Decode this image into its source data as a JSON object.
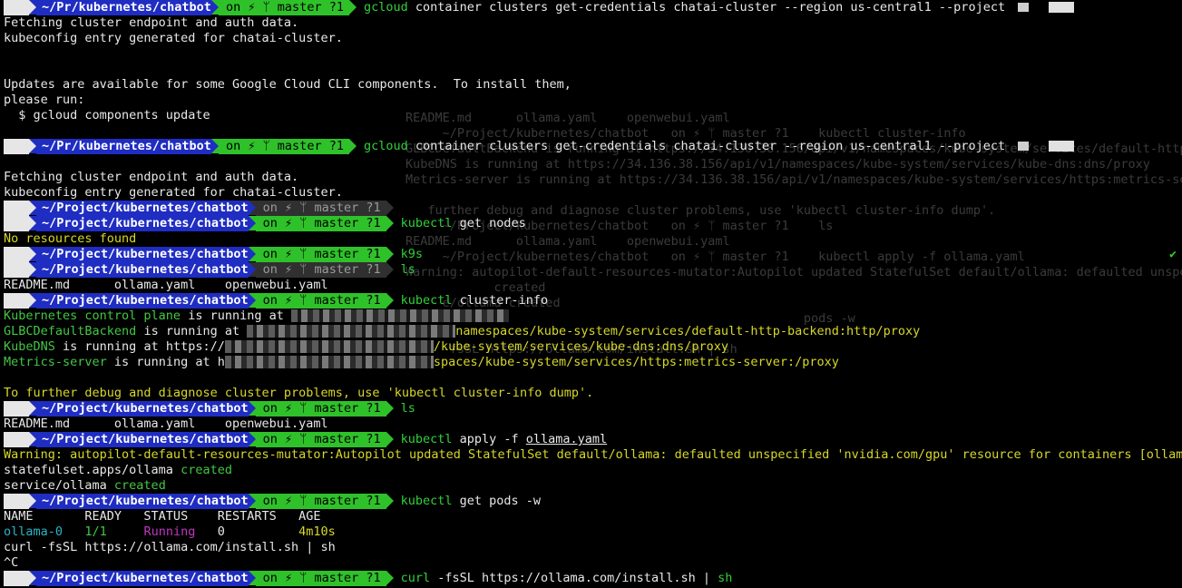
{
  "prompt": {
    "apple_glyph": "",
    "git_label": "on ⚡ ᛘ master ?1",
    "path_short": "~/Pr/kubernetes/chatbot",
    "path_full": "~/Project/kubernetes/chatbot"
  },
  "lines": [
    {
      "kind": "prompt",
      "path": "~/Pr/kubernetes/chatbot",
      "git": "on ⚡ ᛘ master ?1",
      "cmd": "gcloud",
      "args": " container clusters get-credentials chatai-cluster --region us-central1 --project ",
      "redact": true
    },
    {
      "kind": "text",
      "text": "Fetching cluster endpoint and auth data."
    },
    {
      "kind": "text",
      "text": "kubeconfig entry generated for chatai-cluster."
    },
    {
      "kind": "text",
      "text": ""
    },
    {
      "kind": "text",
      "text": ""
    },
    {
      "kind": "text",
      "text": "Updates are available for some Google Cloud CLI components.  To install them,"
    },
    {
      "kind": "text",
      "text": "please run:"
    },
    {
      "kind": "text",
      "text": "  $ gcloud components update"
    },
    {
      "kind": "text",
      "text": ""
    },
    {
      "kind": "prompt",
      "path": "~/Pr/kubernetes/chatbot",
      "git": "on ⚡ ᛘ master ?1",
      "cmd": "gcloud",
      "args": " container clusters get-credentials chatai-cluster --region us-central1 --project ",
      "redact": true
    },
    {
      "kind": "text",
      "text": ""
    },
    {
      "kind": "text",
      "text": "Fetching cluster endpoint and auth data."
    },
    {
      "kind": "text",
      "text": "kubeconfig entry generated for chatai-cluster."
    },
    {
      "kind": "prompt",
      "path": "~/Project/kubernetes/chatbot",
      "git": "on ⚡ ᛘ master ?1",
      "grey": true,
      "cmd": "",
      "args": ""
    },
    {
      "kind": "prompt",
      "path": "~/Project/kubernetes/chatbot",
      "git": "on ⚡ ᛘ master ?1",
      "cmd": "kubectl",
      "args": " get nodes"
    },
    {
      "kind": "colored",
      "color": "yellow",
      "text": "No resources found"
    },
    {
      "kind": "prompt",
      "path": "~/Project/kubernetes/chatbot",
      "git": "on ⚡ ᛘ master ?1",
      "cmd": "k9s",
      "args": ""
    },
    {
      "kind": "prompt",
      "path": "~/Project/kubernetes/chatbot",
      "git": "on ⚡ ᛘ master ?1",
      "grey": true,
      "cmd": "ls",
      "args": ""
    },
    {
      "kind": "text",
      "text": "README.md      ollama.yaml    openwebui.yaml"
    },
    {
      "kind": "prompt",
      "path": "~/Project/kubernetes/chatbot",
      "git": "on ⚡ ᛘ master ?1",
      "cmd": "kubectl",
      "args": " cluster-info"
    },
    {
      "kind": "info",
      "label": "Kubernetes control plane",
      "mid": " is running at ",
      "tail": ""
    },
    {
      "kind": "info",
      "label": "GLBCDefaultBackend",
      "mid": " is running at ",
      "tail": "namespaces/kube-system/services/default-http-backend:http/proxy"
    },
    {
      "kind": "info",
      "label": "KubeDNS",
      "mid": " is running at https://",
      "tail": "/kube-system/services/kube-dns:dns/proxy"
    },
    {
      "kind": "info",
      "label": "Metrics-server",
      "mid": " is running at h",
      "tail": "spaces/kube-system/services/https:metrics-server:/proxy"
    },
    {
      "kind": "text",
      "text": ""
    },
    {
      "kind": "colored",
      "color": "yellow",
      "text": "To further debug and diagnose cluster problems, use 'kubectl cluster-info dump'."
    },
    {
      "kind": "prompt",
      "path": "~/Project/kubernetes/chatbot",
      "git": "on ⚡ ᛘ master ?1",
      "cmd": "ls",
      "args": ""
    },
    {
      "kind": "text",
      "text": "README.md      ollama.yaml    openwebui.yaml"
    },
    {
      "kind": "prompt",
      "path": "~/Project/kubernetes/chatbot",
      "git": "on ⚡ ᛘ master ?1",
      "cmd": "kubectl",
      "args": " apply -f ",
      "underlined": "ollama.yaml"
    },
    {
      "kind": "colored",
      "color": "yellow",
      "text": "Warning: autopilot-default-resources-mutator:Autopilot updated StatefulSet default/ollama: defaulted unspecified 'nvidia.com/gpu' resource for containers [ollama]"
    },
    {
      "kind": "created",
      "prefix": "statefulset.apps/ollama ",
      "word": "created"
    },
    {
      "kind": "created",
      "prefix": "service/ollama ",
      "word": "created"
    },
    {
      "kind": "prompt",
      "path": "~/Project/kubernetes/chatbot",
      "git": "on ⚡ ᛘ master ?1",
      "cmd": "kubectl",
      "args": " get pods -w"
    },
    {
      "kind": "text",
      "text": "NAME       READY   STATUS    RESTARTS   AGE"
    },
    {
      "kind": "pod",
      "name": "ollama-0",
      "ready": "1/1",
      "status": "Running",
      "restarts": "0",
      "age": "4m10s"
    },
    {
      "kind": "text",
      "text": "curl -fsSL https://ollama.com/install.sh | sh"
    },
    {
      "kind": "text",
      "text": "^C"
    },
    {
      "kind": "prompt",
      "path": "~/Project/kubernetes/chatbot",
      "git": "on ⚡ ᛘ master ?1",
      "cmd": "curl",
      "args": " -fsSL https://ollama.com/install.sh | ",
      "tailcmd": "sh"
    }
  ],
  "ghost": [
    "README.md      ollama.yaml    openwebui.yaml",
    "     ~/Project/kubernetes/chatbot   on ⚡ ᛘ master ?1    kubectl cluster-info",
    "GLBCDefaultBackend is running at https://34.136.38.156/api/v1/namespaces/kube-system/services/default-http-",
    "KubeDNS is running at https://34.136.38.156/api/v1/namespaces/kube-system/services/kube-dns:dns/proxy",
    "Metrics-server is running at https://34.136.38.156/api/v1/namespaces/kube-system/services/https:metrics-ser",
    "",
    "   further debug and diagnose cluster problems, use 'kubectl cluster-info dump'.",
    "     ~/Project/kubernetes/chatbot   on ⚡ ᛘ master ?1    ls",
    "README.md      ollama.yaml    openwebui.yaml",
    "     ~/Project/kubernetes/chatbot   on ⚡ ᛘ master ?1    kubectl apply -f ollama.yaml",
    "Warning: autopilot-default-resources-mutator:Autopilot updated StatefulSet default/ollama: defaulted unspeci",
    "            created",
    "     e/ollama created",
    "                                                      pods -w",
    "",
    "curl -fsSL https://ollama.com/install.sh | sh"
  ],
  "checkmark": "✔"
}
